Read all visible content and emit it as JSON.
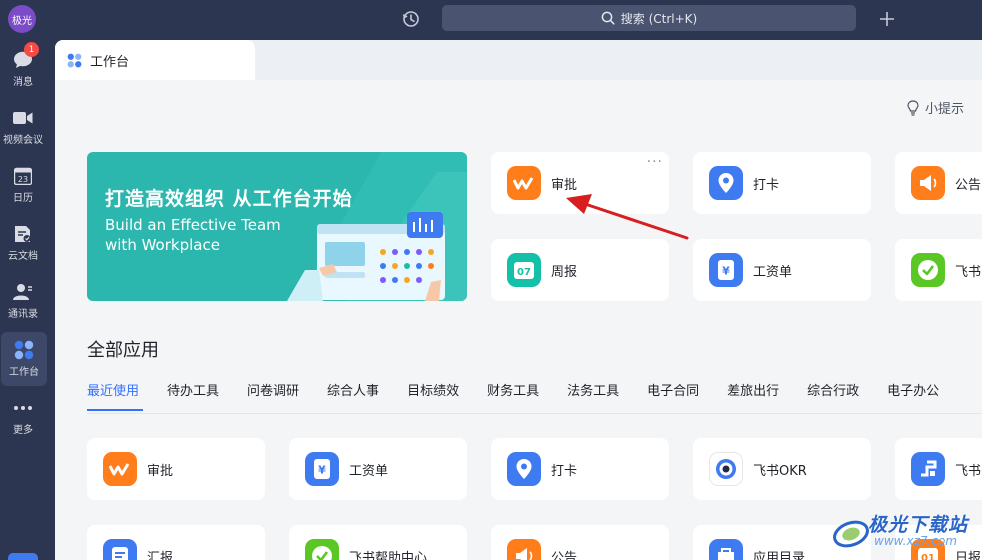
{
  "topbar": {
    "avatar_text": "极光",
    "search_placeholder": "搜索 (Ctrl+K)"
  },
  "sidebar": {
    "items": [
      {
        "label": "消息",
        "badge": "1"
      },
      {
        "label": "视频会议"
      },
      {
        "label": "日历",
        "icon_text": "23"
      },
      {
        "label": "云文档"
      },
      {
        "label": "通讯录"
      },
      {
        "label": "工作台"
      },
      {
        "label": "更多"
      }
    ]
  },
  "tab": {
    "label": "工作台"
  },
  "tips": {
    "label": "小提示"
  },
  "banner": {
    "title": "打造高效组织 从工作台开始",
    "subtitle_line1": "Build an Effective Team",
    "subtitle_line2": "with Workplace"
  },
  "featured_apps": [
    {
      "label": "审批",
      "color": "#ff7d1a",
      "icon": "approval-icon"
    },
    {
      "label": "打卡",
      "color": "#3f7bf0",
      "icon": "location-icon"
    },
    {
      "label": "公告",
      "color": "#ff7d1a",
      "icon": "speaker-icon"
    },
    {
      "label": "周报",
      "color": "#14c0a8",
      "icon": "weekly-report-icon",
      "icon_text": "07"
    },
    {
      "label": "工资单",
      "color": "#3f7bf0",
      "icon": "payroll-icon",
      "icon_text": "¥"
    },
    {
      "label": "飞书",
      "color": "#5ac725",
      "icon": "check-icon"
    }
  ],
  "section": {
    "title": "全部应用"
  },
  "categories": [
    "最近使用",
    "待办工具",
    "问卷调研",
    "综合人事",
    "目标绩效",
    "财务工具",
    "法务工具",
    "电子合同",
    "差旅出行",
    "综合行政",
    "电子办公"
  ],
  "recent_apps": [
    {
      "label": "审批",
      "color": "#ff7d1a",
      "icon": "approval-icon"
    },
    {
      "label": "工资单",
      "color": "#3f7bf0",
      "icon": "payroll-icon",
      "icon_text": "¥"
    },
    {
      "label": "打卡",
      "color": "#3f7bf0",
      "icon": "location-icon"
    },
    {
      "label": "飞书OKR",
      "color": "#3f7bf0",
      "icon": "okr-icon"
    },
    {
      "label": "飞书",
      "color": "#3f7bf0",
      "icon": "feishu-icon"
    },
    {
      "label": "汇报",
      "color": "#3f7bf0",
      "icon": "report-icon"
    },
    {
      "label": "飞书帮助中心",
      "color": "#5ac725",
      "icon": "help-icon"
    },
    {
      "label": "公告",
      "color": "#ff7d1a",
      "icon": "speaker-icon"
    },
    {
      "label": "应用目录",
      "color": "#3f7bf0",
      "icon": "app-catalog-icon"
    },
    {
      "label": "日报",
      "color": "#ff7d1a",
      "icon": "daily-report-icon",
      "icon_text": "01"
    }
  ],
  "watermark": {
    "text": "极光下载站",
    "url": "www.xz7.com"
  }
}
